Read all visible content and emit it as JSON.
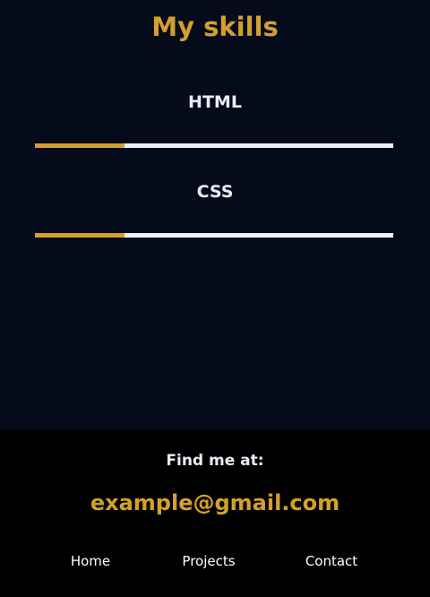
{
  "skills_section": {
    "title": "My skills",
    "skills": [
      {
        "label": "HTML",
        "level_percent": 25
      },
      {
        "label": "CSS",
        "level_percent": 25
      }
    ]
  },
  "footer": {
    "heading": "Find me at:",
    "email": "example@gmail.com",
    "nav": [
      {
        "label": "Home"
      },
      {
        "label": "Projects"
      },
      {
        "label": "Contact"
      }
    ]
  },
  "colors": {
    "accent": "#d4a02d",
    "section_background": "#050b1a",
    "footer_background": "#000000",
    "bar_track": "#e8f0ff",
    "text_light": "#e8edf7"
  }
}
